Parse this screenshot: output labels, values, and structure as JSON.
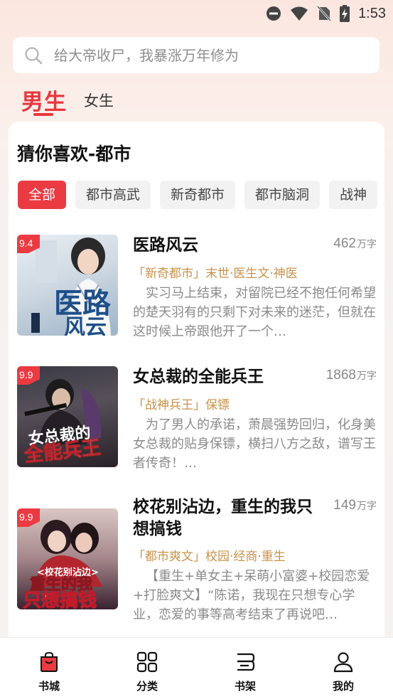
{
  "status_bar": {
    "time": "1:53"
  },
  "search": {
    "placeholder": "给大帝收尸，我暴涨万年修为"
  },
  "gender_tabs": [
    {
      "label": "男生",
      "active": true
    },
    {
      "label": "女生",
      "active": false
    }
  ],
  "section": {
    "title": "猜你喜欢-都市",
    "chips": [
      {
        "label": "全部",
        "active": true
      },
      {
        "label": "都市高武",
        "active": false
      },
      {
        "label": "新奇都市",
        "active": false
      },
      {
        "label": "都市脑洞",
        "active": false
      },
      {
        "label": "战神",
        "active": false
      }
    ]
  },
  "books": [
    {
      "rating": "9.4",
      "title": "医路风云",
      "count": "462",
      "unit": "万字",
      "tags": "「新奇都市」末世·医生文·神医",
      "desc": "实习马上结束，对留院已经不抱任何希望的楚天羽有的只剩下对未来的迷茫，但就在这时候上帝跟他开了一个…",
      "cover_text": "医路风云"
    },
    {
      "rating": "9.9",
      "title": "女总裁的全能兵王",
      "count": "1868",
      "unit": "万字",
      "tags": "「战神兵王」保镖",
      "desc": "为了男人的承诺，萧晨强势回归，化身美女总裁的贴身保镖，横扫八方之敌，谱写王者传奇！…",
      "cover_text": "女总裁的全能兵王"
    },
    {
      "rating": "9.9",
      "title": "校花别沾边，重生的我只想搞钱",
      "count": "149",
      "unit": "万字",
      "tags": "「都市爽文」校园·经商·重生",
      "desc": "【重生+单女主+呆萌小富婆+校园恋爱+打脸爽文】“陈诺，我现在只想专心学业，恋爱的事等高考结束了再说吧…",
      "cover_text": "重生的我只想搞钱"
    }
  ],
  "bottom_nav": [
    {
      "label": "书城",
      "icon": "bookstore-icon",
      "active": true
    },
    {
      "label": "分类",
      "icon": "category-grid-icon",
      "active": false
    },
    {
      "label": "书架",
      "icon": "bookshelf-icon",
      "active": false
    },
    {
      "label": "我的",
      "icon": "profile-icon",
      "active": false
    }
  ],
  "colors": {
    "accent": "#ea3b42",
    "tag": "#c8924a"
  }
}
